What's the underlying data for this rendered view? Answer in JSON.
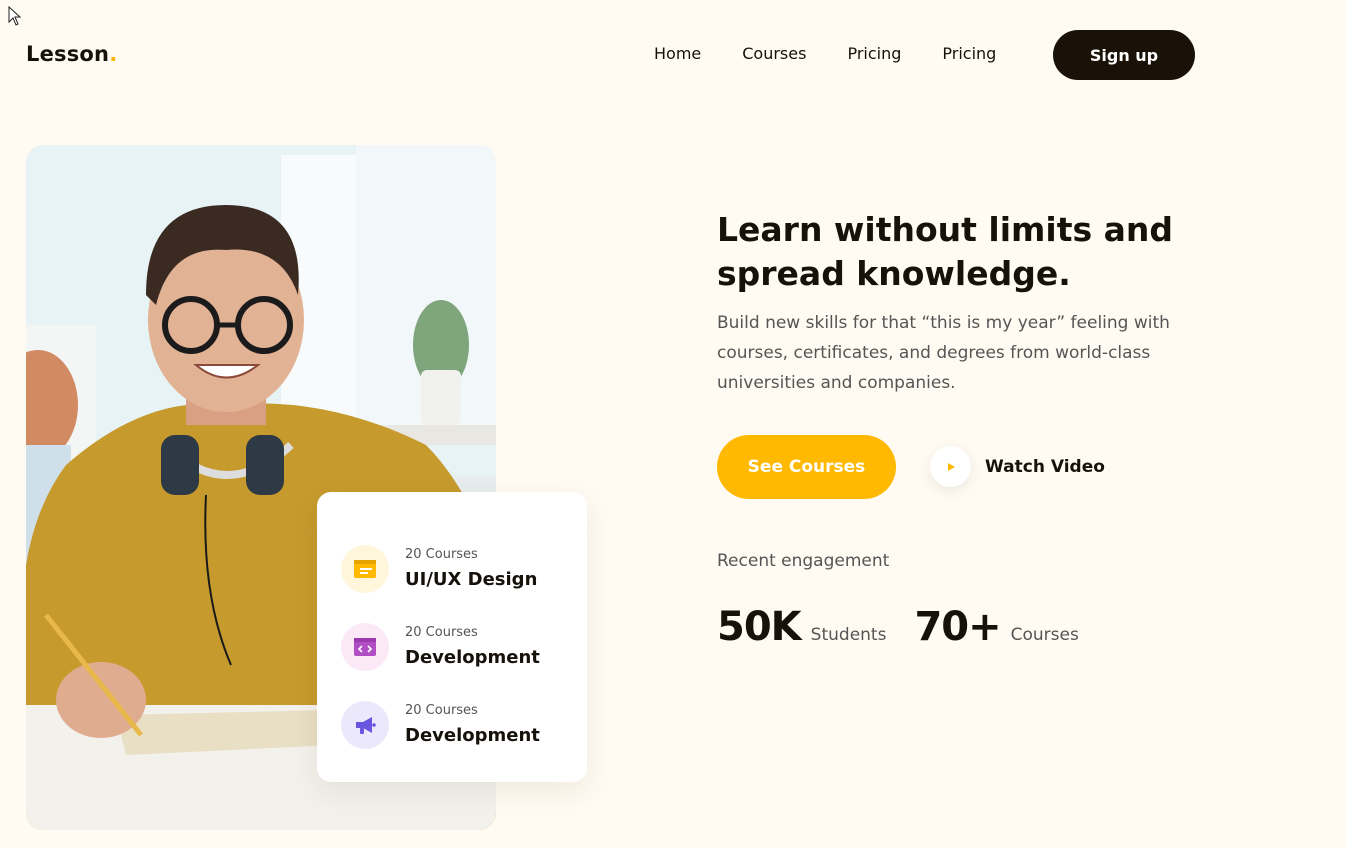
{
  "brand": {
    "name": "Lesson",
    "dot": ".",
    "accent": "#ffb900"
  },
  "nav": {
    "items": [
      "Home",
      "Courses",
      "Pricing",
      "Pricing"
    ],
    "signup_label": "Sign up"
  },
  "hero": {
    "headline": "Learn without limits and spread knowledge.",
    "subtext": "Build new skills for that “this is my year” feeling with courses, certificates, and degrees from world-class universities and companies.",
    "primary_cta": "See Courses",
    "secondary_cta": "Watch Video",
    "photo_icon": "student-with-headphones-photo"
  },
  "courses": [
    {
      "count": "20 Courses",
      "name": "UI/UX Design",
      "icon": "browser-window-icon",
      "icon_bg": "#fff6dc",
      "icon_color": "#ffb900"
    },
    {
      "count": "20 Courses",
      "name": "Development",
      "icon": "code-window-icon",
      "icon_bg": "#fbe9f7",
      "icon_color": "#b24ec4"
    },
    {
      "count": "20 Courses",
      "name": "Development",
      "icon": "megaphone-icon",
      "icon_bg": "#ebe8fb",
      "icon_color": "#6a55e0"
    }
  ],
  "engagement": {
    "label": "Recent engagement",
    "stats": [
      {
        "value": "50K",
        "unit": "Students"
      },
      {
        "value": "70+",
        "unit": "Courses"
      }
    ]
  },
  "colors": {
    "background": "#fffbf2",
    "dark": "#1a1207",
    "accent": "#ffb900"
  }
}
